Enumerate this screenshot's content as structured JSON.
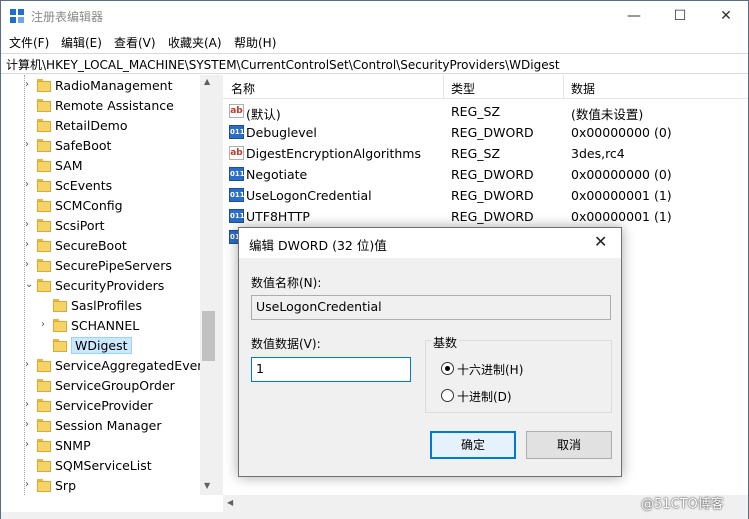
{
  "window": {
    "title": "注册表编辑器"
  },
  "menu": [
    "文件(F)",
    "编辑(E)",
    "查看(V)",
    "收藏夹(A)",
    "帮助(H)"
  ],
  "address": "计算机\\HKEY_LOCAL_MACHINE\\SYSTEM\\CurrentControlSet\\Control\\SecurityProviders\\WDigest",
  "tree": [
    {
      "label": "RadioManagement",
      "chev": "›"
    },
    {
      "label": "Remote Assistance",
      "chev": ""
    },
    {
      "label": "RetailDemo",
      "chev": ""
    },
    {
      "label": "SafeBoot",
      "chev": "›"
    },
    {
      "label": "SAM",
      "chev": ""
    },
    {
      "label": "ScEvents",
      "chev": "›"
    },
    {
      "label": "SCMConfig",
      "chev": ""
    },
    {
      "label": "ScsiPort",
      "chev": "›"
    },
    {
      "label": "SecureBoot",
      "chev": "›"
    },
    {
      "label": "SecurePipeServers",
      "chev": "›"
    },
    {
      "label": "SecurityProviders",
      "chev": "⌄"
    },
    {
      "label": "SaslProfiles",
      "chev": ""
    },
    {
      "label": "SCHANNEL",
      "chev": "›"
    },
    {
      "label": "WDigest",
      "chev": ""
    },
    {
      "label": "ServiceAggregatedEvent",
      "chev": "›"
    },
    {
      "label": "ServiceGroupOrder",
      "chev": ""
    },
    {
      "label": "ServiceProvider",
      "chev": "›"
    },
    {
      "label": "Session Manager",
      "chev": "›"
    },
    {
      "label": "SNMP",
      "chev": "›"
    },
    {
      "label": "SQMServiceList",
      "chev": ""
    },
    {
      "label": "Srp",
      "chev": "›"
    }
  ],
  "list": {
    "headers": {
      "name": "名称",
      "type": "类型",
      "data": "数据"
    },
    "rows": [
      {
        "icon": "ab",
        "name": "(默认)",
        "type": "REG_SZ",
        "data": "(数值未设置)"
      },
      {
        "icon": "011",
        "name": "Debuglevel",
        "type": "REG_DWORD",
        "data": "0x00000000 (0)"
      },
      {
        "icon": "ab",
        "name": "DigestEncryptionAlgorithms",
        "type": "REG_SZ",
        "data": "3des,rc4"
      },
      {
        "icon": "011",
        "name": "Negotiate",
        "type": "REG_DWORD",
        "data": "0x00000000 (0)"
      },
      {
        "icon": "011",
        "name": "UseLogonCredential",
        "type": "REG_DWORD",
        "data": "0x00000001 (1)"
      },
      {
        "icon": "011",
        "name": "UTF8HTTP",
        "type": "REG_DWORD",
        "data": "0x00000001 (1)"
      },
      {
        "icon": "011",
        "name": "",
        "type": "",
        "data": "001 (1)"
      }
    ]
  },
  "dialog": {
    "title": "编辑 DWORD (32 位)值",
    "name_label": "数值名称(N):",
    "name_value": "UseLogonCredential",
    "data_label": "数值数据(V):",
    "data_value": "1",
    "base_label": "基数",
    "radio_hex": "十六进制(H)",
    "radio_dec": "十进制(D)",
    "ok": "确定",
    "cancel": "取消"
  },
  "watermark": "@51CTO博客",
  "colors": {
    "accent": "#0078d7",
    "selection": "#cce8ff",
    "folder": "#f6d365"
  }
}
